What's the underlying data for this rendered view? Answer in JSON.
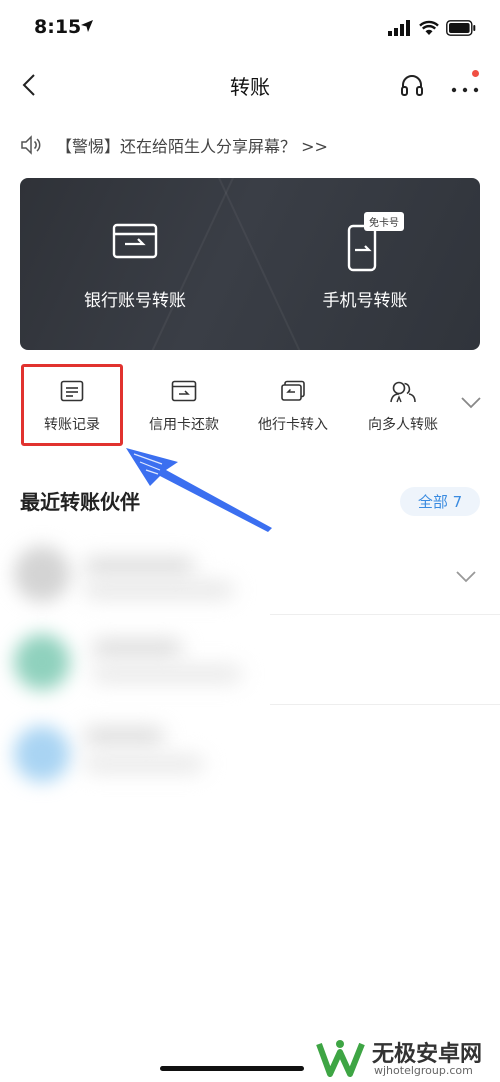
{
  "status_bar": {
    "time": "8:15"
  },
  "nav": {
    "title": "转账"
  },
  "notice": {
    "text": "【警惕】还在给陌生人分享屏幕？ >>"
  },
  "banner": {
    "bank_transfer_label": "银行账号转账",
    "phone_transfer_label": "手机号转账",
    "free_card_tag": "免卡号"
  },
  "quick_actions": [
    {
      "label": "转账记录",
      "icon": "document-icon"
    },
    {
      "label": "信用卡还款",
      "icon": "credit-card-icon"
    },
    {
      "label": "他行卡转入",
      "icon": "card-transfer-in-icon"
    },
    {
      "label": "向多人转账",
      "icon": "multi-person-icon"
    }
  ],
  "partners": {
    "title": "最近转账伙伴",
    "all_label": "全部 7"
  },
  "watermark": {
    "name": "无极安卓网",
    "url": "wjhotelgroup.com"
  },
  "colors": {
    "banner_bg": "#35383f",
    "highlight_red": "#e1322f",
    "badge_blue": "#3a8be0",
    "annotation_arrow": "#3b6ff0"
  }
}
